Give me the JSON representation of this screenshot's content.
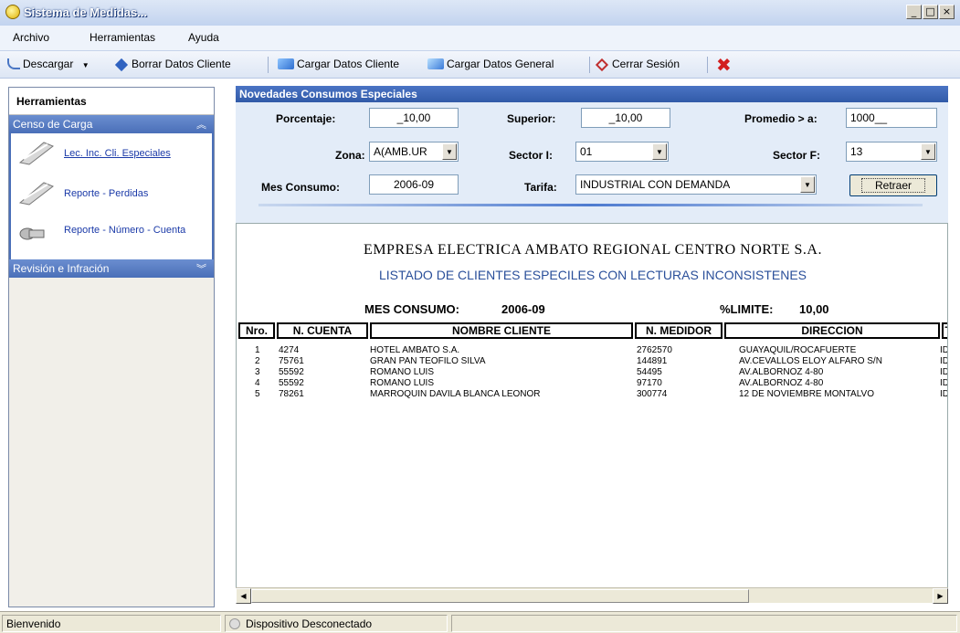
{
  "window": {
    "title": "Sistema de Medidas...",
    "buttons": [
      "_",
      "□",
      "×"
    ]
  },
  "menu": {
    "items": [
      "Archivo",
      "Herramientas",
      "Ayuda"
    ]
  },
  "toolbar": {
    "descargar": "Descargar",
    "borrar": "Borrar Datos Cliente",
    "cargar_cliente": "Cargar Datos Cliente",
    "cargar_general": "Cargar Datos General",
    "cerrar": "Cerrar Sesión",
    "close_color": "#d21f1f"
  },
  "sidebar": {
    "header": "Herramientas",
    "groups": [
      {
        "label": "Censo de Carga",
        "chevron": "≈"
      },
      {
        "label": "Revisión e Infración",
        "chevron": "≈"
      }
    ],
    "items": [
      {
        "label": "Lec. Inc. Cli. Especiales",
        "icon": "calipers-icon"
      },
      {
        "label": "Reporte - Perdidas",
        "icon": "calipers-icon"
      },
      {
        "label": "Reporte - Número - Cuenta",
        "icon": "pipe-icon"
      }
    ]
  },
  "panel": {
    "title": "Novedades Consumos Especiales",
    "porcentaje_label": "Porcentaje:",
    "porcentaje_value": "_10,00",
    "superior_label": "Superior:",
    "superior_value": "_10,00",
    "promedio_label": "Promedio > a:",
    "promedio_value": "1000__",
    "zona_label": "Zona:",
    "zona_value": "A(AMB.UR",
    "sector_i_label": "Sector I:",
    "sector_i_value": "01",
    "sector_f_label": "Sector F:",
    "sector_f_value": "13",
    "mes_label": "Mes Consumo:",
    "mes_value": "2006-09",
    "tarifa_label": "Tarifa:",
    "tarifa_value": "INDUSTRIAL CON DEMANDA",
    "retraer": "Retraer"
  },
  "report": {
    "company": "EMPRESA ELECTRICA AMBATO REGIONAL CENTRO NORTE S.A.",
    "subtitle": "LISTADO DE CLIENTES ESPECILES CON LECTURAS INCONSISTENES",
    "mes_label": "MES CONSUMO:",
    "mes_value": "2006-09",
    "limite_label": "%LIMITE:",
    "limite_value": "10,00",
    "columns": [
      "Nro.",
      "N. CUENTA",
      "NOMBRE CLIENTE",
      "N. MEDIDOR",
      "DIRECCION",
      "T"
    ],
    "rows": [
      [
        "1",
        "4274",
        "HOTEL AMBATO S.A.",
        "2762570",
        "GUAYAQUIL/ROCAFUERTE",
        "ID"
      ],
      [
        "2",
        "75761",
        "GRAN PAN TEOFILO SILVA",
        "144891",
        "AV.CEVALLOS ELOY ALFARO S/N",
        "ID"
      ],
      [
        "3",
        "55592",
        "ROMANO LUIS",
        "54495",
        "AV.ALBORNOZ 4-80",
        "ID"
      ],
      [
        "4",
        "55592",
        "ROMANO LUIS",
        "97170",
        "AV.ALBORNOZ 4-80",
        "ID"
      ],
      [
        "5",
        "78261",
        "MARROQUIN DAVILA BLANCA LEONOR",
        "300774",
        "12 DE NOVIEMBRE MONTALVO",
        "ID"
      ]
    ]
  },
  "status": {
    "left": "Bienvenido",
    "device": "Dispositivo Desconectado"
  }
}
